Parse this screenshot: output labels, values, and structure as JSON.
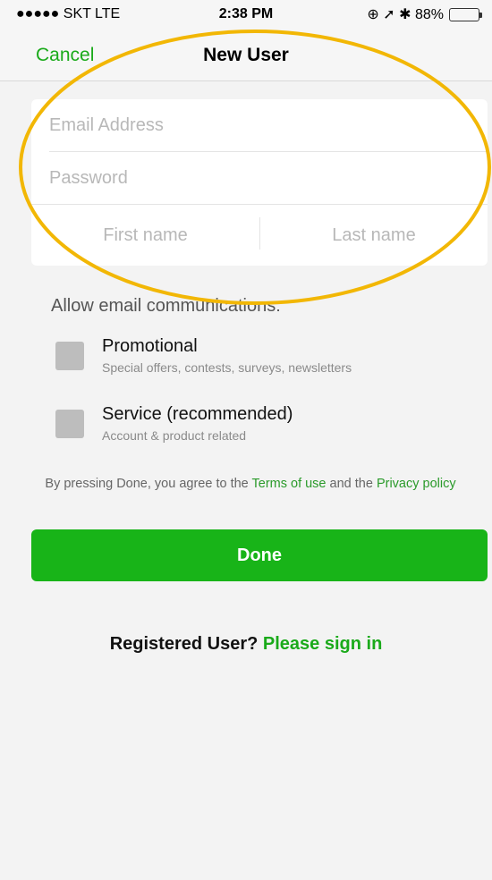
{
  "status_bar": {
    "carrier": "●●●●● SKT  LTE",
    "time": "2:38 PM",
    "indicators": "⊕ ➚ ✱ 88%",
    "battery_level": 0.88
  },
  "nav": {
    "cancel_label": "Cancel",
    "title": "New User"
  },
  "form": {
    "email_placeholder": "Email Address",
    "password_placeholder": "Password",
    "first_name_placeholder": "First name",
    "last_name_placeholder": "Last name"
  },
  "communications": {
    "heading": "Allow email communications:",
    "options": [
      {
        "title": "Promotional",
        "subtitle": "Special offers, contests, surveys, newsletters"
      },
      {
        "title": "Service (recommended)",
        "subtitle": "Account & product related"
      }
    ]
  },
  "terms": {
    "prefix": "By pressing Done, you agree to the ",
    "terms_link": "Terms of use",
    "middle": " and the ",
    "privacy_link": "Privacy policy"
  },
  "done_label": "Done",
  "registered": {
    "question": "Registered User? ",
    "signin_link": "Please sign in"
  },
  "colors": {
    "accent_green": "#18b418",
    "annotation_ellipse": "#f2b705"
  }
}
